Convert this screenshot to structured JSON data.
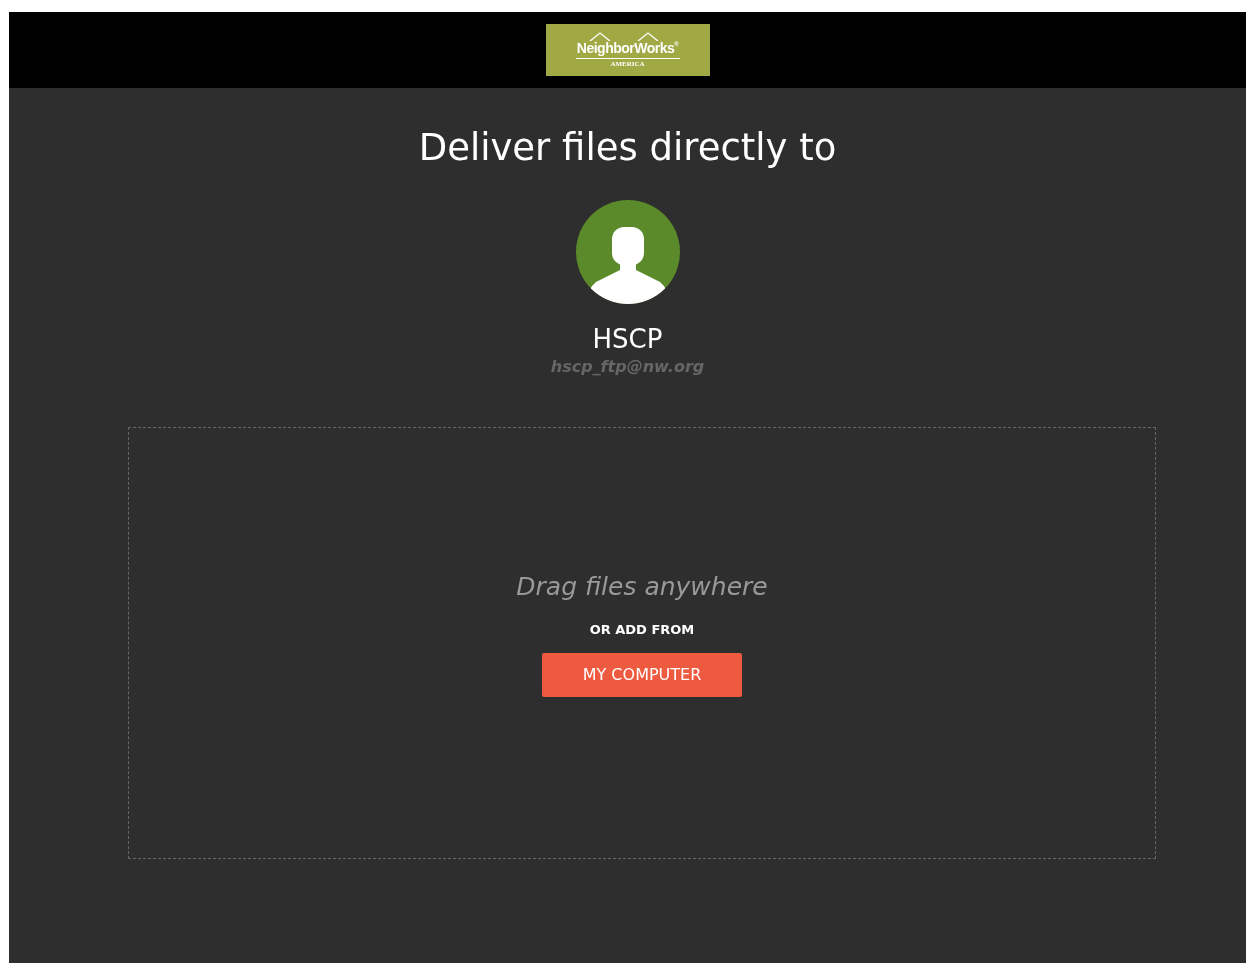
{
  "header": {
    "logo": {
      "name": "NeighborWorks",
      "mark": "®",
      "subtitle": "AMERICA"
    }
  },
  "heading": "Deliver files directly to",
  "recipient": {
    "name": "HSCP",
    "email": "hscp_ftp@nw.org"
  },
  "dropzone": {
    "hint": "Drag files anywhere",
    "or_label": "OR ADD FROM",
    "button": "MY COMPUTER"
  }
}
